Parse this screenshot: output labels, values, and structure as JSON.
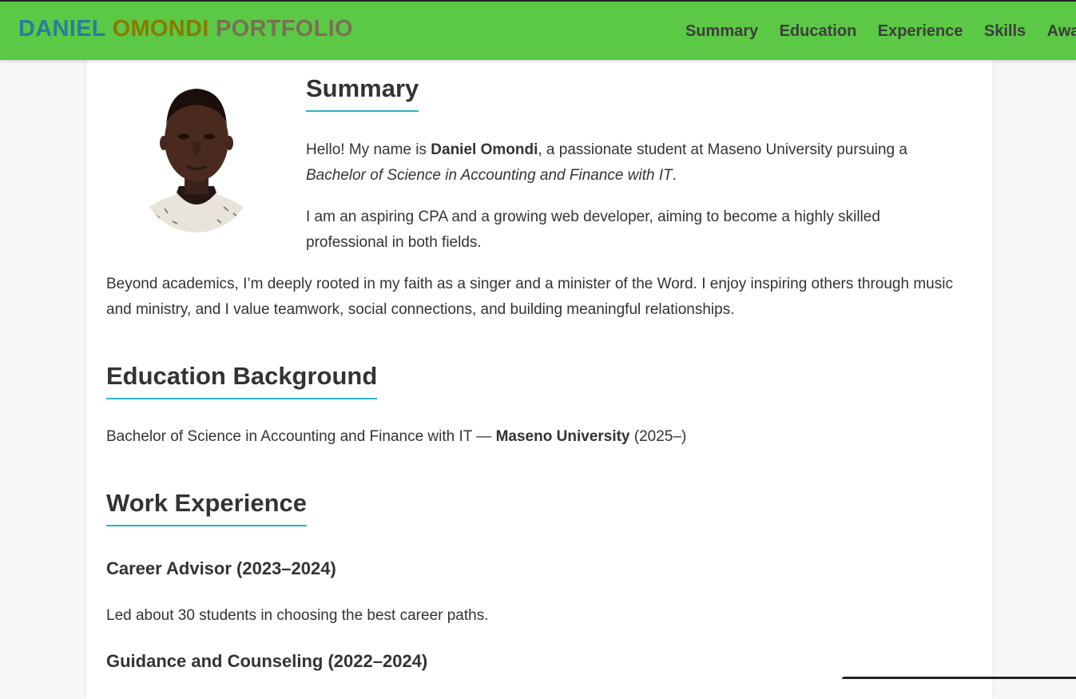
{
  "header": {
    "brand_first": "DANIEL",
    "brand_last": "OMONDI",
    "brand_suffix": "PORTFOLIO",
    "nav": [
      "Summary",
      "Education",
      "Experience",
      "Skills",
      "Awa"
    ]
  },
  "summary": {
    "heading": "Summary",
    "p1_pre": "Hello! My name is ",
    "p1_name": "Daniel Omondi",
    "p1_post": ", a passionate student at Maseno University pursuing a ",
    "p1_degree": "Bachelor of Science in Accounting and Finance with IT",
    "p1_end": ".",
    "p2": "I am an aspiring CPA and a growing web developer, aiming to become a highly skilled professional in both fields.",
    "p3": "Beyond academics, I’m deeply rooted in my faith as a singer and a minister of the Word. I enjoy inspiring others through music and ministry, and I value teamwork, social connections, and building meaningful relationships."
  },
  "education": {
    "heading": "Education Background",
    "degree": "Bachelor of Science in Accounting and Finance with IT — ",
    "institution": "Maseno University",
    "years": " (2025–)"
  },
  "experience": {
    "heading": "Work Experience",
    "items": [
      {
        "title": "Career Advisor (2023–2024)",
        "description": "Led about 30 students in choosing the best career paths."
      },
      {
        "title": "Guidance and Counseling (2022–2024)"
      }
    ]
  },
  "colors": {
    "header_bg": "#5bc945",
    "heading_underline": "#29b3c7",
    "brand_first": "#2a7d9e",
    "brand_last": "#8a7a00",
    "brand_suffix": "#7a6f55"
  }
}
